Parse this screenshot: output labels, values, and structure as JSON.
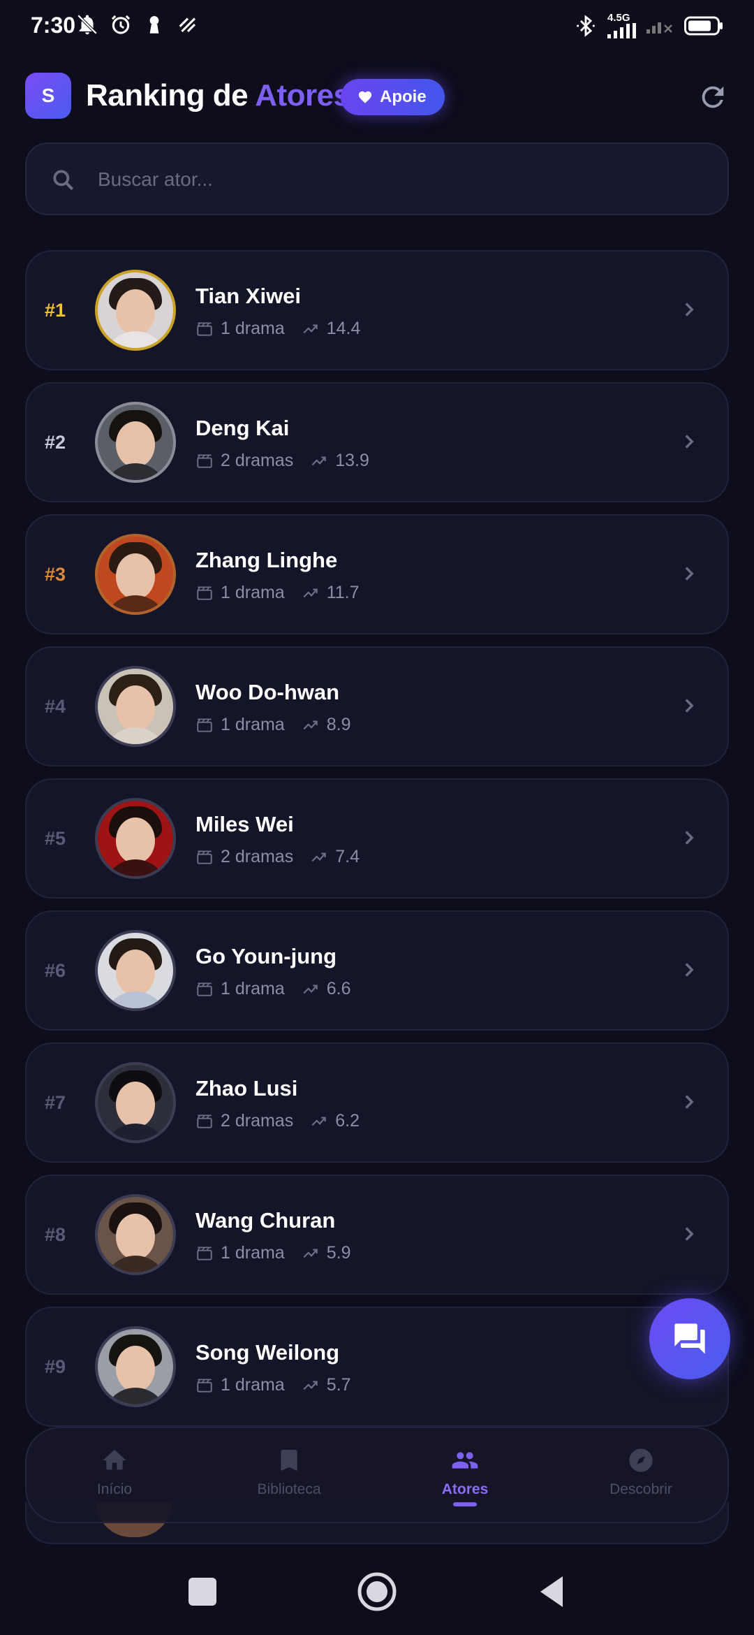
{
  "status_bar": {
    "time": "7:30",
    "network_label": "4.5G",
    "icons": [
      "notifications-off-icon",
      "alarm-icon",
      "keyhole-icon",
      "data-saver-icon",
      "bluetooth-icon",
      "signal-icon",
      "no-signal-icon",
      "battery-icon"
    ]
  },
  "header": {
    "logo_letter": "S",
    "title_main": "Ranking de ",
    "title_accent": "Atores",
    "support_label": "Apoie",
    "refresh_icon": "refresh-icon"
  },
  "search": {
    "placeholder": "Buscar ator..."
  },
  "actors": [
    {
      "rank": "#1",
      "name": "Tian Xiwei",
      "dramas": "1 drama",
      "score": "14.4",
      "rank_color": "#f2c230",
      "ring": "#c9a227",
      "bg": "#d8d4d6",
      "hair": "#231b18",
      "body": "#e8e4e6"
    },
    {
      "rank": "#2",
      "name": "Deng Kai",
      "dramas": "2 dramas",
      "score": "13.9",
      "rank_color": "#c8c8d8",
      "ring": "#8c8c98",
      "bg": "#5a5e66",
      "hair": "#16130f",
      "body": "#2b2d33"
    },
    {
      "rank": "#3",
      "name": "Zhang Linghe",
      "dramas": "1 drama",
      "score": "11.7",
      "rank_color": "#d98a3a",
      "ring": "#b0632b",
      "bg": "#c0481e",
      "hair": "#2a1a12",
      "body": "#5a2a18"
    },
    {
      "rank": "#4",
      "name": "Woo Do-hwan",
      "dramas": "1 drama",
      "score": "8.9",
      "rank_color": "#5a5a78",
      "ring": "#3c3c55",
      "bg": "#c9c2b6",
      "hair": "#2c2016",
      "body": "#d8d2c8"
    },
    {
      "rank": "#5",
      "name": "Miles Wei",
      "dramas": "2 dramas",
      "score": "7.4",
      "rank_color": "#5a5a78",
      "ring": "#3c3c55",
      "bg": "#9e1414",
      "hair": "#1a0f0d",
      "body": "#3a1010"
    },
    {
      "rank": "#6",
      "name": "Go Youn-jung",
      "dramas": "1 drama",
      "score": "6.6",
      "rank_color": "#5a5a78",
      "ring": "#3c3c55",
      "bg": "#d9dbe0",
      "hair": "#241a14",
      "body": "#b8c2d4"
    },
    {
      "rank": "#7",
      "name": "Zhao Lusi",
      "dramas": "2 dramas",
      "score": "6.2",
      "rank_color": "#5a5a78",
      "ring": "#3c3c55",
      "bg": "#2c2e3a",
      "hair": "#0f0d12",
      "body": "#1e2030"
    },
    {
      "rank": "#8",
      "name": "Wang Churan",
      "dramas": "1 drama",
      "score": "5.9",
      "rank_color": "#5a5a78",
      "ring": "#3c3c55",
      "bg": "#6a5448",
      "hair": "#1a1210",
      "body": "#3a2a24"
    },
    {
      "rank": "#9",
      "name": "Song Weilong",
      "dramas": "1 drama",
      "score": "5.7",
      "rank_color": "#5a5a78",
      "ring": "#3c3c55",
      "bg": "#9a9ea6",
      "hair": "#161410",
      "body": "#2a2c32"
    }
  ],
  "chat_button_icon": "chat-icon",
  "bottom_nav": [
    {
      "label": "Início",
      "icon": "home-icon",
      "active": false
    },
    {
      "label": "Biblioteca",
      "icon": "bookmark-icon",
      "active": false
    },
    {
      "label": "Atores",
      "icon": "people-icon",
      "active": true
    },
    {
      "label": "Descobrir",
      "icon": "compass-icon",
      "active": false
    }
  ],
  "colors": {
    "accent": "#7d5ff2",
    "background": "#0d0d1c",
    "card": "#151529"
  }
}
